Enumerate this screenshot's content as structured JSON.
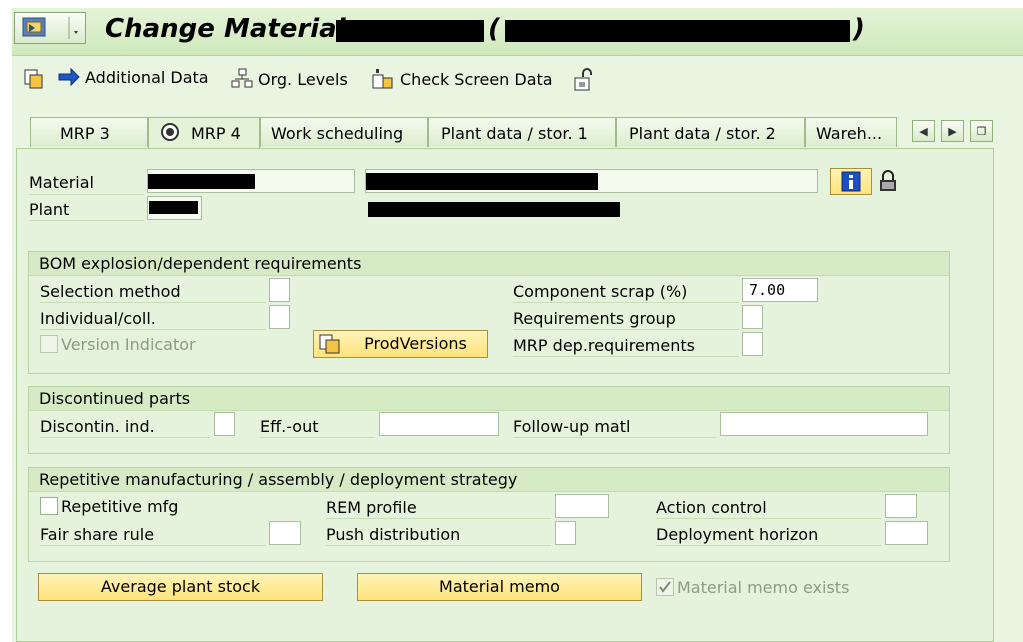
{
  "title": {
    "text": "Change Material",
    "open_paren": "(",
    "close_paren": ")"
  },
  "toolbar": {
    "additional_data": "Additional Data",
    "org_levels": "Org. Levels",
    "check_screen_data": "Check Screen Data"
  },
  "tabs": [
    {
      "label": "MRP 3"
    },
    {
      "label": "MRP 4"
    },
    {
      "label": "Work scheduling"
    },
    {
      "label": "Plant data / stor. 1"
    },
    {
      "label": "Plant data / stor. 2"
    },
    {
      "label": "Wareh..."
    }
  ],
  "header": {
    "material_label": "Material",
    "plant_label": "Plant"
  },
  "bom": {
    "title": "BOM explosion/dependent requirements",
    "selection_method": "Selection method",
    "individual_coll": "Individual/coll.",
    "version_indicator": "Version Indicator",
    "prodversions": "ProdVersions",
    "component_scrap": "Component scrap (%)",
    "component_scrap_value": "7.00",
    "requirements_group": "Requirements group",
    "mrp_dep_requirements": "MRP dep.requirements"
  },
  "discontinued": {
    "title": "Discontinued parts",
    "discontin_ind": "Discontin. ind.",
    "eff_out": "Eff.-out",
    "follow_up": "Follow-up matl"
  },
  "repetitive": {
    "title": "Repetitive manufacturing / assembly / deployment strategy",
    "repetitive_mfg": "Repetitive mfg",
    "rem_profile": "REM profile",
    "action_control": "Action control",
    "fair_share": "Fair share rule",
    "push_distribution": "Push distribution",
    "deployment_horizon": "Deployment horizon"
  },
  "bottom": {
    "average_plant_stock": "Average plant stock",
    "material_memo": "Material memo",
    "material_memo_exists": "Material memo exists",
    "material_memo_exists_checked": true
  }
}
